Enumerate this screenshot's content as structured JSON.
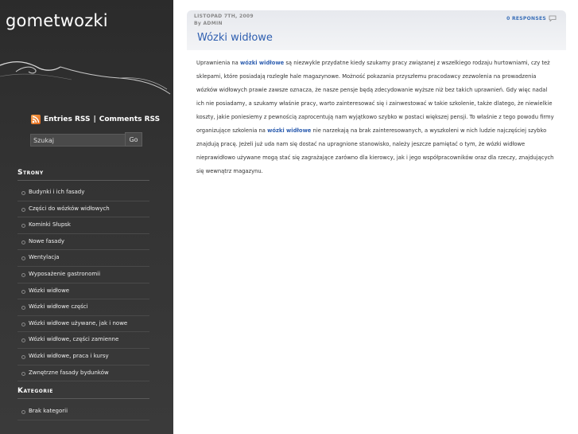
{
  "site": {
    "title": "gometwozki"
  },
  "feeds": {
    "entries_label": "Entries RSS",
    "separator": "|",
    "comments_label": "Comments RSS"
  },
  "search": {
    "value": "Szukaj",
    "button_label": "Go"
  },
  "sidebar": {
    "strony": {
      "heading": "Strony",
      "items": [
        "Budynki i ich fasady",
        "Części do wózków widłowych",
        "Kominki Słupsk",
        "Nowe fasady",
        "Wentylacja",
        "Wyposażenie gastronomii",
        "Wózki widłowe",
        "Wózki widłowe części",
        "Wózki widłowe używane, jak i nowe",
        "Wózki widłowe, części zamienne",
        "Wózki widłowe, praca i kursy",
        "Zwnętrzne fasady bydunków"
      ]
    },
    "kategorie": {
      "heading": "Kategorie",
      "items": [
        "Brak kategorii"
      ]
    }
  },
  "post": {
    "date": "LISTOPAD 7TH, 2009",
    "author": "By ADMIN",
    "responses": "0 RESPONSES",
    "title": "Wózki widłowe",
    "body": {
      "p1_before": "Uprawnienia na ",
      "link1": "wózki widłowe",
      "p1_mid": " są niezwykle przydatne kiedy szukamy pracy związanej z wszelkiego rodzaju hurtowniami, czy też sklepami, które posiadają rozległe hale magazynowe. Możność pokazania przyszłemu pracodawcy zezwolenia na prowadzenia wózków widłowych prawie zawsze oznacza, że nasze pensje będą zdecydowanie wyższe niż bez takich uprawnień. Gdy więc nadal ich nie posiadamy, a szukamy właśnie pracy, warto zainteresować się i zainwestować w takie szkolenie, także dlatego, że niewielkie koszty, jakie poniesiemy z pewnością zaprocentują nam wyjątkowo szybko w postaci większej pensji. To właśnie z tego powodu firmy organizujące szkolenia na ",
      "link2": "wózki widłowe",
      "p1_after": " nie narzekają na brak zainteresowanych, a wyszkoleni w nich ludzie najczęściej szybko znajdują pracę. Jeżeli już uda nam się dostać na upragnione stanowisko, należy jeszcze pamiętać o tym, że wózki widłowe nieprawidłowo używane mogą stać się zagrażające zarówno dla kierowcy, jak i jego współpracowników oraz dla rzeczy, znajdujących się wewnątrz magazynu."
    }
  }
}
